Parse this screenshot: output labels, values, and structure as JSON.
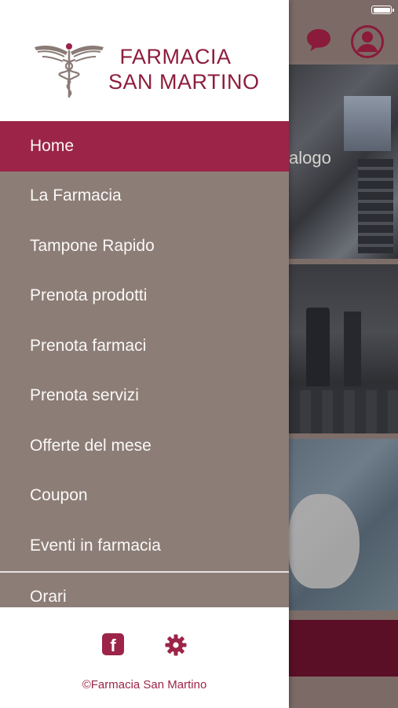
{
  "background": {
    "image_caption": "alogo"
  },
  "drawer": {
    "brand": {
      "line1": "FARMACIA",
      "line2": "SAN MARTINO"
    },
    "menu": [
      {
        "label": "Home",
        "active": true
      },
      {
        "label": "La  Farmacia",
        "active": false
      },
      {
        "label": "Tampone  Rapido",
        "active": false
      },
      {
        "label": "Prenota prodotti",
        "active": false
      },
      {
        "label": "Prenota farmaci",
        "active": false
      },
      {
        "label": "Prenota servizi",
        "active": false
      },
      {
        "label": "Offerte del mese",
        "active": false
      },
      {
        "label": "Coupon",
        "active": false
      },
      {
        "label": "Eventi in farmacia",
        "active": false
      },
      {
        "label": "Orari",
        "active": false
      }
    ],
    "footer": {
      "facebook_glyph": "f",
      "copyright": "©Farmacia San  Martino"
    }
  },
  "icons": {
    "header": [
      "chat-icon",
      "user-icon"
    ],
    "footer": [
      "facebook-icon",
      "gear-icon"
    ]
  },
  "colors": {
    "brand": "#9c2448",
    "drawer_bg": "#8c7d77",
    "header_white": "#ffffff"
  }
}
